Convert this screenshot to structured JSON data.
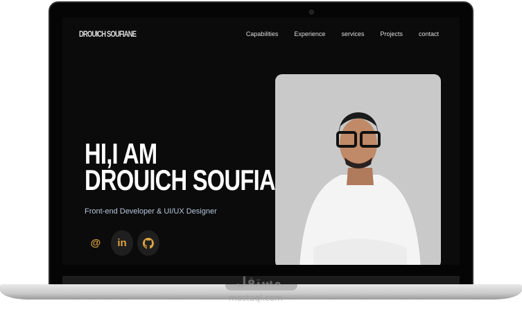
{
  "site": {
    "logo": "DROUICH SOUFIANE",
    "nav": [
      "Capabilities",
      "Experience",
      "services",
      "Projects",
      "contact"
    ],
    "hero_line1": "HI,I AM",
    "hero_line2": "DROUICH SOUFIANE.",
    "subtitle": "Front-end Developer & UI/UX Designer",
    "social": [
      {
        "icon": "at-icon",
        "glyph": "@"
      },
      {
        "icon": "linkedin-icon",
        "glyph": "in"
      },
      {
        "icon": "github-icon",
        "glyph": "⌥"
      }
    ],
    "accent": "#e0a544"
  },
  "watermark": {
    "arabic": "مستقل",
    "latin": "mostaql.com"
  }
}
